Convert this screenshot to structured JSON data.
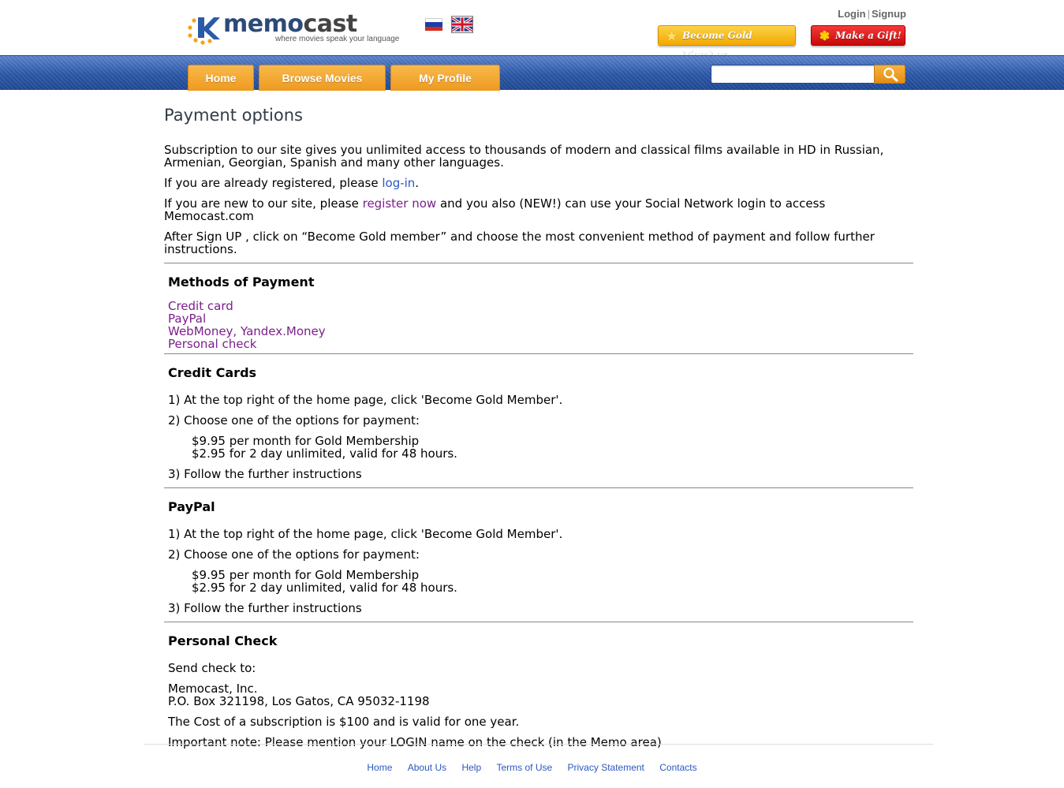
{
  "header": {
    "logo_text_a": "memo",
    "logo_text_b": "cast",
    "tagline": "where movies speak your language",
    "login": "Login",
    "separator": "|",
    "signup": "Signup",
    "gold_button": "Become Gold Member",
    "gift_button": "Make a Gift!",
    "flag_ru_colors": [
      "#ffffff",
      "#1c3fa8",
      "#d52b1e"
    ]
  },
  "nav": {
    "tabs": [
      {
        "label": "Home"
      },
      {
        "label": "Browse Movies"
      },
      {
        "label": "My Profile"
      }
    ],
    "search_value": "",
    "search_icon": "search-icon"
  },
  "main": {
    "title": "Payment options",
    "intro1": "Subscription to our site gives you unlimited access to thousands of modern and classical films available in HD in Russian, Armenian, Georgian, Spanish and many other languages.",
    "intro2_prefix": "If you are already registered, please ",
    "intro2_link": "log-in",
    "intro2_suffix": ".",
    "intro3_prefix": "If you are new to our site, please ",
    "intro3_link": "register now",
    "intro3_suffix": " and you also (NEW!) can use your Social Network login to access Memocast.com",
    "intro4": "After Sign UP , click on “Become Gold member” and choose the most convenient method of payment and follow further instructions.",
    "methods": {
      "heading": "Methods of Payment",
      "links": [
        "Credit card",
        "PayPal",
        "WebMoney, Yandex.Money",
        "Personal check"
      ]
    },
    "credit": {
      "heading": "Credit Cards",
      "step1": "1) At the top right of the home page, click 'Become Gold Member'.",
      "step2": "2) Choose one of the options for payment:",
      "option1": "$9.95 per month for Gold Membership",
      "option2": "$2.95 for 2 day unlimited, valid for 48 hours.",
      "step3": "3) Follow the further instructions"
    },
    "paypal": {
      "heading": "PayPal",
      "step1": "1) At the top right of the home page, click 'Become Gold Member'.",
      "step2": "2) Choose one of the options for payment:",
      "option1": "$9.95 per month for Gold Membership",
      "option2": "$2.95 for 2 day unlimited, valid for 48 hours.",
      "step3": "3) Follow the further instructions"
    },
    "check": {
      "heading": "Personal Check",
      "send_to": "Send check to:",
      "addr1": "Memocast, Inc.",
      "addr2": "P.O. Box 321198, Los Gatos, CA 95032-1198",
      "cost": "The Cost of a subscription is $100 and is valid for one year.",
      "note": "Important note: Please mention your LOGIN name on the check (in the Memo area)"
    }
  },
  "footer": {
    "links": [
      "Home",
      "About Us",
      "Help",
      "Terms of Use",
      "Privacy Statement",
      "Contacts"
    ]
  }
}
